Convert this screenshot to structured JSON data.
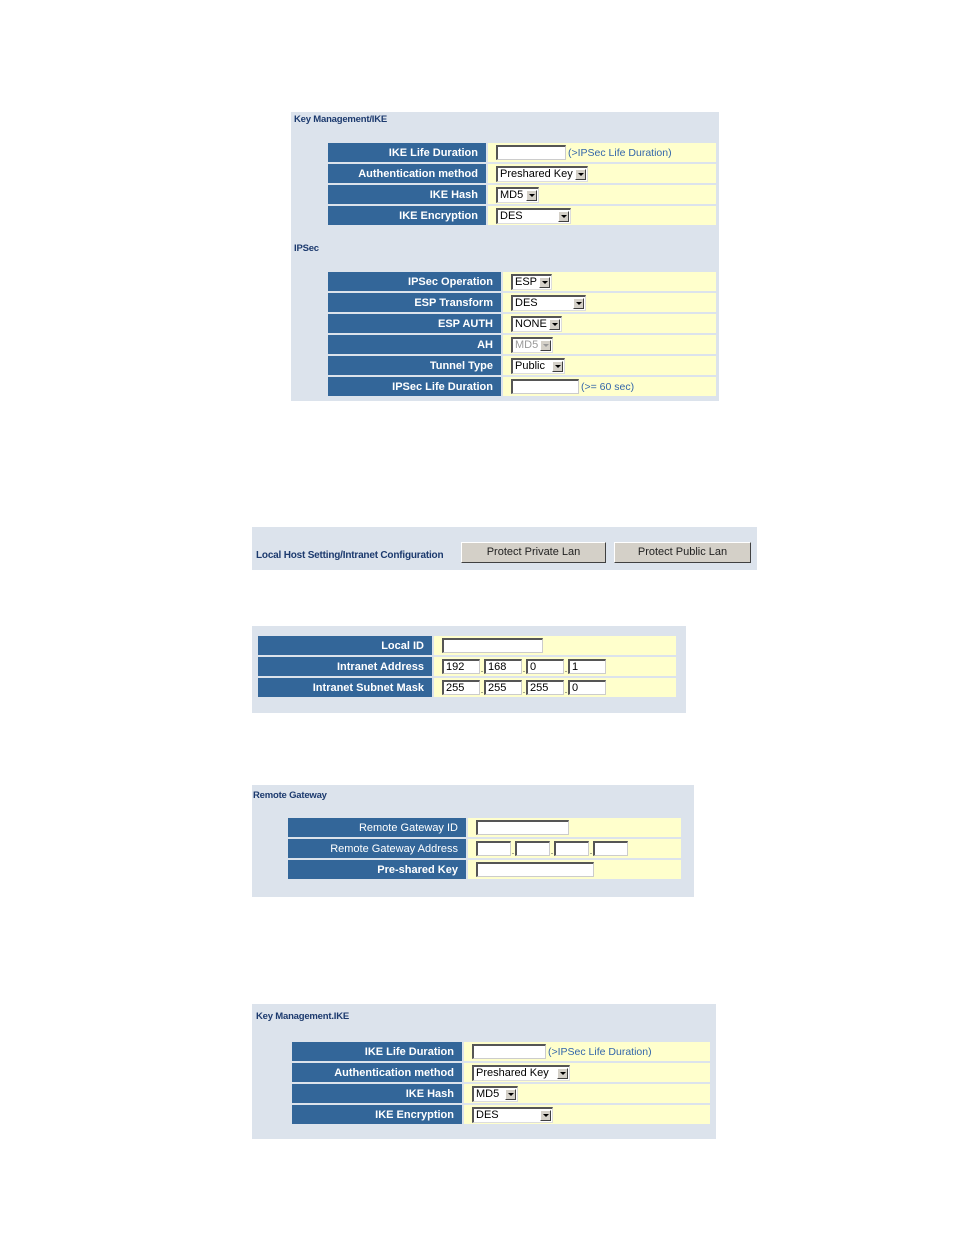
{
  "ike_top": {
    "title": "Key Management/IKE",
    "rows": [
      {
        "label": "IKE Life Duration",
        "type": "text",
        "value": "",
        "hint": "(>IPSec Life Duration)"
      },
      {
        "label": "Authentication method",
        "type": "select",
        "value": "Preshared Key"
      },
      {
        "label": "IKE Hash",
        "type": "select",
        "value": "MD5"
      },
      {
        "label": "IKE Encryption",
        "type": "select",
        "value": "DES"
      }
    ]
  },
  "ipsec": {
    "title": "IPSec",
    "rows": [
      {
        "label": "IPSec Operation",
        "type": "select",
        "value": "ESP"
      },
      {
        "label": "ESP Transform",
        "type": "select",
        "value": "DES"
      },
      {
        "label": "ESP AUTH",
        "type": "select",
        "value": "NONE"
      },
      {
        "label": "AH",
        "type": "select",
        "value": "MD5",
        "disabled": true
      },
      {
        "label": "Tunnel Type",
        "type": "select",
        "value": "Public"
      },
      {
        "label": "IPSec Life Duration",
        "type": "text",
        "value": "",
        "hint": "(>= 60 sec)"
      }
    ]
  },
  "local_host": {
    "title": "Local Host Setting/Intranet Configuration",
    "buttons": [
      "Protect Private Lan",
      "Protect Public Lan"
    ]
  },
  "intranet": {
    "rows": [
      {
        "label": "Local ID",
        "value": ""
      },
      {
        "label": "Intranet Address",
        "octets": [
          "192",
          "168",
          "0",
          "1"
        ]
      },
      {
        "label": "Intranet Subnet Mask",
        "octets": [
          "255",
          "255",
          "255",
          "0"
        ]
      }
    ]
  },
  "remote_gateway": {
    "title": "Remote Gateway",
    "rows": [
      {
        "label": "Remote Gateway ID",
        "value": ""
      },
      {
        "label": "Remote Gateway Address",
        "octets": [
          "",
          "",
          "",
          ""
        ]
      },
      {
        "label": "Pre-shared Key",
        "value": ""
      }
    ]
  },
  "ike_bottom": {
    "title": "Key Management.IKE",
    "rows": [
      {
        "label": "IKE Life Duration",
        "type": "text",
        "value": "",
        "hint": "(>IPSec Life Duration)"
      },
      {
        "label": "Authentication method",
        "type": "select",
        "value": "Preshared Key"
      },
      {
        "label": "IKE Hash",
        "type": "select",
        "value": "MD5"
      },
      {
        "label": "IKE Encryption",
        "type": "select",
        "value": "DES"
      }
    ]
  },
  "colors": {
    "label_bg": "#336699",
    "value_bg": "#ffffcc",
    "panel_bg": "#dce3ec",
    "title": "#1c3a6e",
    "hint": "#3366aa"
  }
}
